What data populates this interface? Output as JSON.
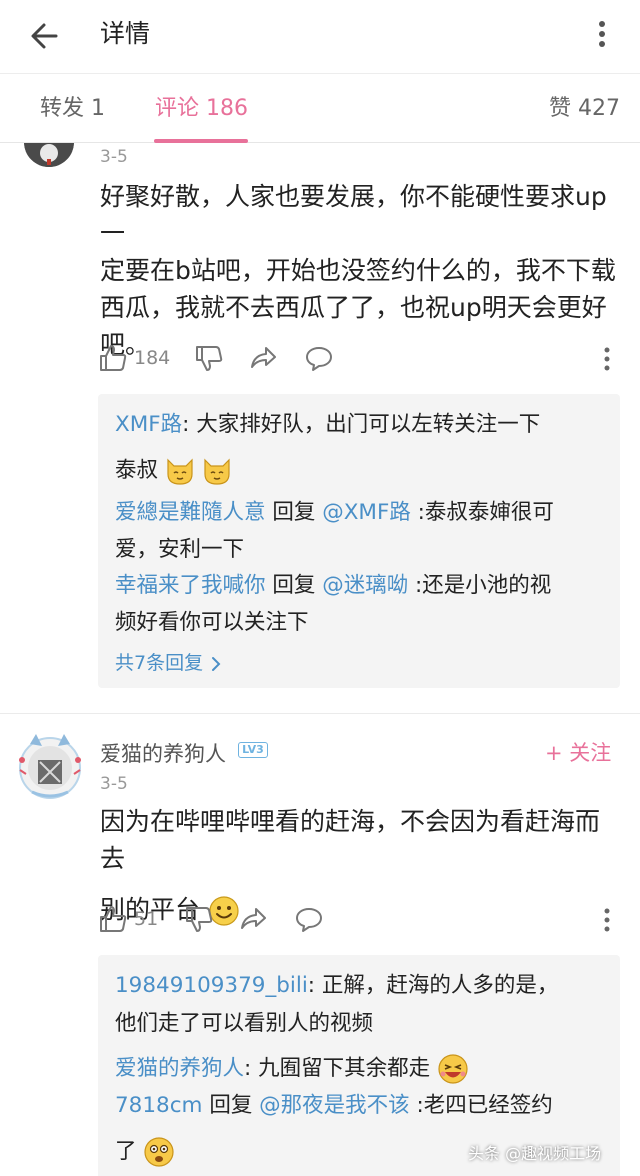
{
  "header": {
    "title": "详情"
  },
  "tabs": {
    "forward": "转发 1",
    "comments": "评论 186",
    "likes": "赞 427"
  },
  "comment1": {
    "date": "3-5",
    "lines": [
      "好聚好散，人家也要发展，你不能硬性要求up一",
      "定要在b站吧，开始也没签约什么的，我不下载",
      "西瓜，我就不去西瓜了了，也祝up明天会更好",
      "吧。"
    ],
    "likes": "184",
    "replies": [
      {
        "user": "XMF路",
        "sep": ": ",
        "text1": "大家排好队，出门可以左转关注一下",
        "text2": "泰叔"
      },
      {
        "user": "爱總是難隨人意",
        "mid": " 回复 ",
        "target": "@XMF路",
        "sep": " :",
        "text1": "泰叔泰婶很可",
        "text2": "爱，安利一下"
      },
      {
        "user": "幸福来了我喊你",
        "mid": " 回复 ",
        "target": "@迷璃呦",
        "sep": " :",
        "text1": "还是小池的视",
        "text2": "频好看你可以关注下"
      }
    ],
    "reply_total": "共7条回复"
  },
  "comment2": {
    "username": "爱猫的养狗人",
    "level": "LV3",
    "follow": "+ 关注",
    "date": "3-5",
    "lines": [
      "因为在哔哩哔哩看的赶海，不会因为看赶海而去",
      "别的平台"
    ],
    "likes": "51",
    "replies": [
      {
        "user": "19849109379_bili",
        "sep": ": ",
        "text1": "正解，赶海的人多的是，",
        "text2": "他们走了可以看别人的视频"
      },
      {
        "user": "爱猫的养狗人",
        "sep": ": ",
        "text1": "九囿留下其余都走"
      },
      {
        "user": "7818cm",
        "mid": " 回复 ",
        "target": "@那夜是我不该",
        "sep": " :",
        "text1": "老四已经签约",
        "text2": "了"
      }
    ]
  },
  "watermark": {
    "prefix": "头条 @",
    "brand": "趣视频工场"
  },
  "colors": {
    "accent": "#e8719a",
    "link": "#4a8fc7",
    "reply_bg": "#f4f4f4"
  },
  "icons": [
    "back-arrow-icon",
    "more-vertical-icon",
    "thumb-up-icon",
    "thumb-down-icon",
    "share-icon",
    "comment-icon",
    "cat-emoji-icon",
    "smile-emoji-icon",
    "laugh-emoji-icon",
    "shocked-emoji-icon",
    "chevron-right-icon"
  ]
}
